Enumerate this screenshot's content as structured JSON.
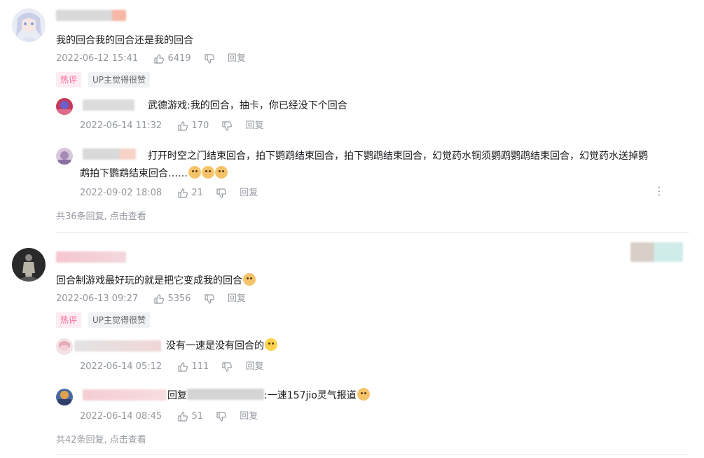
{
  "comments": [
    {
      "text": "我的回合我的回合还是我的回合",
      "time": "2022-06-12 15:41",
      "likes": "6419",
      "reply_label": "回复",
      "tags": [
        "热评",
        "UP主觉得很赞"
      ],
      "replies": [
        {
          "text": "武德游戏:我的回合，抽卡，你已经没下个回合",
          "time": "2022-06-14 11:32",
          "likes": "170",
          "reply_label": "回复"
        },
        {
          "text_line1": "打开时空之门结束回合，拍下鹦鹉结束回合，拍下鹦鹉结束回合，幻觉药水铜须鹦鹉鹦鹉结束回合，幻觉药水送掉鹦",
          "text_line2": "鹉拍下鹦鹉结束回合……",
          "time": "2022-09-02 18:08",
          "likes": "21",
          "reply_label": "回复"
        }
      ],
      "more": "共36条回复, 点击查看"
    },
    {
      "text": "回合制游戏最好玩的就是把它变成我的回合",
      "time": "2022-06-13 09:27",
      "likes": "5356",
      "reply_label": "回复",
      "tags": [
        "热评",
        "UP主觉得很赞"
      ],
      "replies": [
        {
          "text": "没有一速是没有回合的",
          "time": "2022-06-14 05:12",
          "likes": "111",
          "reply_label": "回复"
        },
        {
          "prefix": "回复",
          "text": ":一速157jio灵气报道",
          "time": "2022-06-14 08:45",
          "likes": "51",
          "reply_label": "回复"
        }
      ],
      "more": "共42条回复, 点击查看"
    }
  ],
  "icons": {
    "like": "thumbs-up-icon",
    "dislike": "thumbs-down-icon",
    "more": "more-dots-icon",
    "emoji": "cat-face-emoji-icon"
  },
  "colors": {
    "meta": "#9499a0",
    "hot_tag_bg": "#fdecf2",
    "hot_tag_text": "#ff6699",
    "divider": "#e3e5e7"
  }
}
